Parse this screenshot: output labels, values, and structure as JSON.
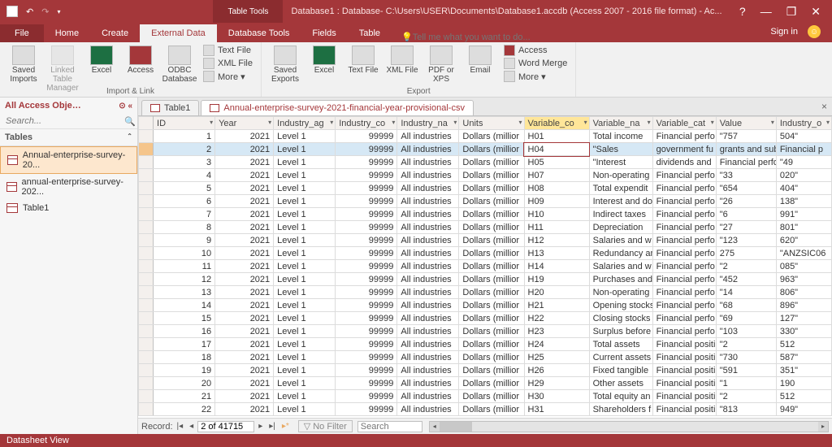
{
  "titlebar": {
    "tabletools": "Table Tools",
    "title": "Database1 : Database- C:\\Users\\USER\\Documents\\Database1.accdb (Access 2007 - 2016 file format) - Ac...",
    "help": "?",
    "restore": "❐",
    "close": "✕"
  },
  "tabs": {
    "file": "File",
    "home": "Home",
    "create": "Create",
    "external": "External Data",
    "dbtools": "Database Tools",
    "fields": "Fields",
    "table": "Table",
    "tellme_icon": "💡",
    "tellme": "Tell me what you want to do...",
    "signin": "Sign in"
  },
  "ribbon": {
    "saved_imports": "Saved\nImports",
    "linked_table": "Linked Table\nManager",
    "excel": "Excel",
    "access": "Access",
    "odbc": "ODBC\nDatabase",
    "textfile": "Text File",
    "xmlfile": "XML File",
    "more": "More ▾",
    "group1": "Import & Link",
    "saved_exports": "Saved\nExports",
    "excel2": "Excel",
    "textfile2": "Text\nFile",
    "xmlfile2": "XML\nFile",
    "pdf": "PDF\nor XPS",
    "email": "Email",
    "access2": "Access",
    "wordmerge": "Word Merge",
    "more2": "More ▾",
    "group2": "Export"
  },
  "nav": {
    "header": "All Access Obje…",
    "search": "Search...",
    "section": "Tables",
    "items": [
      "Annual-enterprise-survey-20...",
      "annual-enterprise-survey-202...",
      "Table1"
    ]
  },
  "doctabs": {
    "t1": "Table1",
    "t2": "Annual-enterprise-survey-2021-financial-year-provisional-csv"
  },
  "columns": [
    "ID",
    "Year",
    "Industry_ag",
    "Industry_co",
    "Industry_na",
    "Units",
    "Variable_co",
    "Variable_na",
    "Variable_cat",
    "Value",
    "Industry_o"
  ],
  "rows": [
    {
      "id": "1",
      "year": "2021",
      "iag": "Level 1",
      "ico": "99999",
      "ina": "All industries",
      "unit": "Dollars (millior",
      "vco": "H01",
      "vna": "Total income",
      "vca": "Financial perfo",
      "val": "\"757",
      "io2": "504\""
    },
    {
      "id": "2",
      "year": "2021",
      "iag": "Level 1",
      "ico": "99999",
      "ina": "All industries",
      "unit": "Dollars (millior",
      "vco": "H04",
      "vna": "\"Sales",
      "vca": "government fu",
      "val": "grants and sub",
      "io2": "Financial p"
    },
    {
      "id": "3",
      "year": "2021",
      "iag": "Level 1",
      "ico": "99999",
      "ina": "All industries",
      "unit": "Dollars (millior",
      "vco": "H05",
      "vna": "\"Interest",
      "vca": "dividends and",
      "val": "Financial perfo",
      "io2": "\"49"
    },
    {
      "id": "4",
      "year": "2021",
      "iag": "Level 1",
      "ico": "99999",
      "ina": "All industries",
      "unit": "Dollars (millior",
      "vco": "H07",
      "vna": "Non-operating",
      "vca": "Financial perfo",
      "val": "\"33",
      "io2": "020\""
    },
    {
      "id": "5",
      "year": "2021",
      "iag": "Level 1",
      "ico": "99999",
      "ina": "All industries",
      "unit": "Dollars (millior",
      "vco": "H08",
      "vna": "Total expendit",
      "vca": "Financial perfo",
      "val": "\"654",
      "io2": "404\""
    },
    {
      "id": "6",
      "year": "2021",
      "iag": "Level 1",
      "ico": "99999",
      "ina": "All industries",
      "unit": "Dollars (millior",
      "vco": "H09",
      "vna": "Interest and do",
      "vca": "Financial perfo",
      "val": "\"26",
      "io2": "138\""
    },
    {
      "id": "7",
      "year": "2021",
      "iag": "Level 1",
      "ico": "99999",
      "ina": "All industries",
      "unit": "Dollars (millior",
      "vco": "H10",
      "vna": "Indirect taxes",
      "vca": "Financial perfo",
      "val": "\"6",
      "io2": "991\""
    },
    {
      "id": "8",
      "year": "2021",
      "iag": "Level 1",
      "ico": "99999",
      "ina": "All industries",
      "unit": "Dollars (millior",
      "vco": "H11",
      "vna": "Depreciation",
      "vca": "Financial perfo",
      "val": "\"27",
      "io2": "801\""
    },
    {
      "id": "9",
      "year": "2021",
      "iag": "Level 1",
      "ico": "99999",
      "ina": "All industries",
      "unit": "Dollars (millior",
      "vco": "H12",
      "vna": "Salaries and w",
      "vca": "Financial perfo",
      "val": "\"123",
      "io2": "620\""
    },
    {
      "id": "10",
      "year": "2021",
      "iag": "Level 1",
      "ico": "99999",
      "ina": "All industries",
      "unit": "Dollars (millior",
      "vco": "H13",
      "vna": "Redundancy an",
      "vca": "Financial perfo",
      "val": "275",
      "io2": "\"ANZSIC06"
    },
    {
      "id": "11",
      "year": "2021",
      "iag": "Level 1",
      "ico": "99999",
      "ina": "All industries",
      "unit": "Dollars (millior",
      "vco": "H14",
      "vna": "Salaries and w",
      "vca": "Financial perfo",
      "val": "\"2",
      "io2": "085\""
    },
    {
      "id": "12",
      "year": "2021",
      "iag": "Level 1",
      "ico": "99999",
      "ina": "All industries",
      "unit": "Dollars (millior",
      "vco": "H19",
      "vna": "Purchases and",
      "vca": "Financial perfo",
      "val": "\"452",
      "io2": "963\""
    },
    {
      "id": "13",
      "year": "2021",
      "iag": "Level 1",
      "ico": "99999",
      "ina": "All industries",
      "unit": "Dollars (millior",
      "vco": "H20",
      "vna": "Non-operating",
      "vca": "Financial perfo",
      "val": "\"14",
      "io2": "806\""
    },
    {
      "id": "14",
      "year": "2021",
      "iag": "Level 1",
      "ico": "99999",
      "ina": "All industries",
      "unit": "Dollars (millior",
      "vco": "H21",
      "vna": "Opening stocks",
      "vca": "Financial perfo",
      "val": "\"68",
      "io2": "896\""
    },
    {
      "id": "15",
      "year": "2021",
      "iag": "Level 1",
      "ico": "99999",
      "ina": "All industries",
      "unit": "Dollars (millior",
      "vco": "H22",
      "vna": "Closing stocks",
      "vca": "Financial perfo",
      "val": "\"69",
      "io2": "127\""
    },
    {
      "id": "16",
      "year": "2021",
      "iag": "Level 1",
      "ico": "99999",
      "ina": "All industries",
      "unit": "Dollars (millior",
      "vco": "H23",
      "vna": "Surplus before",
      "vca": "Financial perfo",
      "val": "\"103",
      "io2": "330\""
    },
    {
      "id": "17",
      "year": "2021",
      "iag": "Level 1",
      "ico": "99999",
      "ina": "All industries",
      "unit": "Dollars (millior",
      "vco": "H24",
      "vna": "Total assets",
      "vca": "Financial positi",
      "val": "\"2",
      "io2": "512"
    },
    {
      "id": "18",
      "year": "2021",
      "iag": "Level 1",
      "ico": "99999",
      "ina": "All industries",
      "unit": "Dollars (millior",
      "vco": "H25",
      "vna": "Current assets",
      "vca": "Financial positi",
      "val": "\"730",
      "io2": "587\""
    },
    {
      "id": "19",
      "year": "2021",
      "iag": "Level 1",
      "ico": "99999",
      "ina": "All industries",
      "unit": "Dollars (millior",
      "vco": "H26",
      "vna": "Fixed tangible",
      "vca": "Financial positi",
      "val": "\"591",
      "io2": "351\""
    },
    {
      "id": "20",
      "year": "2021",
      "iag": "Level 1",
      "ico": "99999",
      "ina": "All industries",
      "unit": "Dollars (millior",
      "vco": "H29",
      "vna": "Other assets",
      "vca": "Financial positi",
      "val": "\"1",
      "io2": "190"
    },
    {
      "id": "21",
      "year": "2021",
      "iag": "Level 1",
      "ico": "99999",
      "ina": "All industries",
      "unit": "Dollars (millior",
      "vco": "H30",
      "vna": "Total equity an",
      "vca": "Financial positi",
      "val": "\"2",
      "io2": "512"
    },
    {
      "id": "22",
      "year": "2021",
      "iag": "Level 1",
      "ico": "99999",
      "ina": "All industries",
      "unit": "Dollars (millior",
      "vco": "H31",
      "vna": "Shareholders f",
      "vca": "Financial positi",
      "val": "\"813",
      "io2": "949\""
    }
  ],
  "recnav": {
    "label": "Record:",
    "value": "2 of 41715",
    "nofilter": "No Filter",
    "search": "Search"
  },
  "status": "Datasheet View"
}
